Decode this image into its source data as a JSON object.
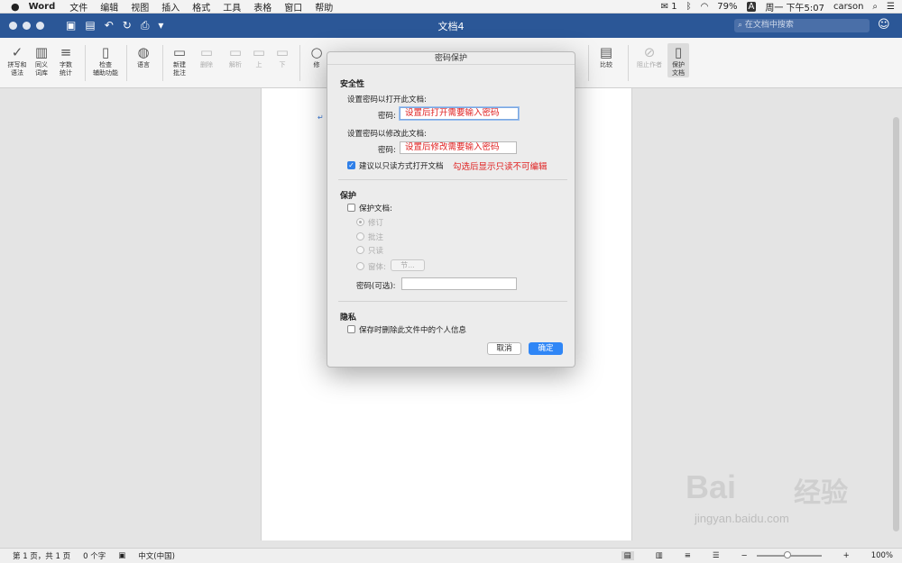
{
  "menubar": {
    "apple": "",
    "app": "Word",
    "items": [
      "文件",
      "编辑",
      "视图",
      "插入",
      "格式",
      "工具",
      "表格",
      "窗口",
      "帮助"
    ],
    "wechat_count": "1",
    "battery": "79%",
    "input_method": "A",
    "clock": "周一 下午5:07",
    "user": "carson"
  },
  "titlebar": {
    "title": "文档4",
    "search_placeholder": "在文档中搜索"
  },
  "ribbon": {
    "spelling": "拼写和\n语法",
    "thesaurus": "同义\n词库",
    "wordcount": "字数\n统计",
    "accessibility": "检查\n辅助功能",
    "language": "语言",
    "new_comment": "新建\n批注",
    "delete": "删除",
    "resolve": "解析",
    "prev": "上",
    "next": "下",
    "track": "修",
    "compare": "比较",
    "block_authors": "阻止作者",
    "protect": "保护\n文档"
  },
  "dialog": {
    "title": "密码保护",
    "security_heading": "安全性",
    "open_label": "设置密码以打开此文档:",
    "password_label": "密码:",
    "open_password_text": "设置后打开需要输入密码",
    "modify_label": "设置密码以修改此文档:",
    "modify_password_text": "设置后修改需要输入密码",
    "readonly_label": "建议以只读方式打开文档",
    "readonly_checked": true,
    "readonly_note": "勾选后显示只读不可编辑",
    "protect_heading": "保护",
    "protect_doc_label": "保护文档:",
    "opt_revisions": "修订",
    "opt_comments": "批注",
    "opt_readonly": "只读",
    "opt_forms": "窗体:",
    "sections_btn": "节...",
    "optional_password_label": "密码(可选):",
    "privacy_heading": "隐私",
    "privacy_label": "保存时删除此文件中的个人信息",
    "cancel": "取消",
    "ok": "确定"
  },
  "status": {
    "page": "第 1 页，共 1 页",
    "words": "0 个字",
    "lang": "中文(中国)",
    "zoom": "100%"
  },
  "watermark": {
    "brand": "Bai",
    "cn": "经验",
    "url": "jingyan.baidu.com"
  },
  "colors": {
    "titlebar": "#2b5797",
    "annotation_red": "#e02020",
    "primary_button": "#2f86f6"
  }
}
